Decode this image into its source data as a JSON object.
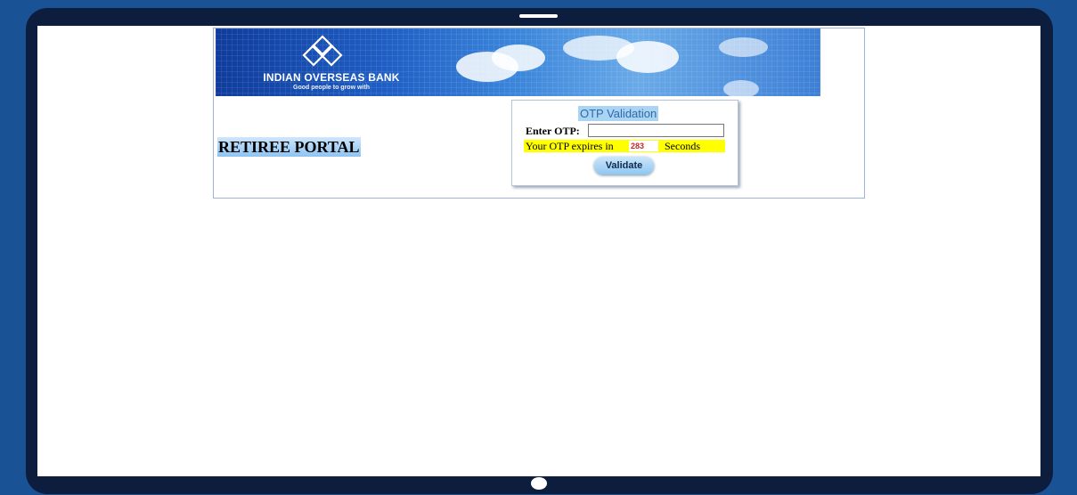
{
  "header": {
    "bank_name": "INDIAN OVERSEAS BANK",
    "tagline": "Good people to grow with"
  },
  "portal": {
    "title": "RETIREE PORTAL"
  },
  "otp": {
    "heading": "OTP Validation",
    "label": "Enter OTP:",
    "input_value": "",
    "expiry_prefix": "Your OTP expires in",
    "countdown": "283",
    "expiry_suffix": "Seconds",
    "validate_label": "Validate"
  },
  "colors": {
    "page_background": "#1a5296",
    "device_frame": "#0d1d3e",
    "expiry_highlight": "#ffff00",
    "countdown_text": "#c62828",
    "button": "#8fc6ef"
  }
}
